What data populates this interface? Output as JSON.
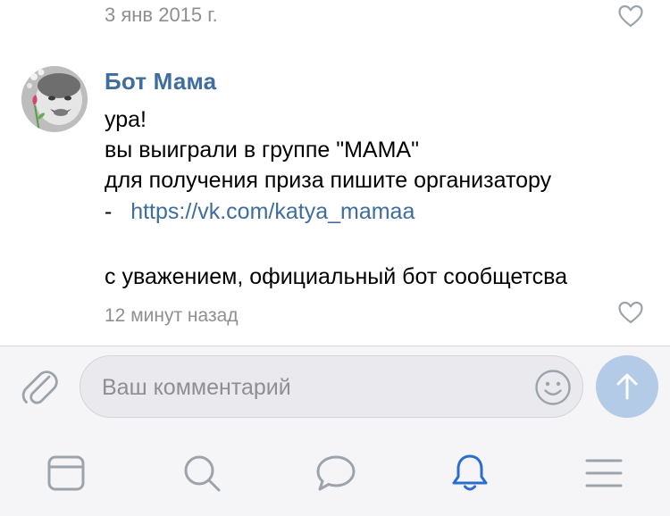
{
  "previous_comment": {
    "date": "3 янв 2015 г.",
    "like_icon": "heart-outline-icon"
  },
  "comment": {
    "author": "Бот Мама",
    "lines": [
      "ура!",
      "вы выиграли в группе \"МАМА\"",
      "для получения приза пишите организатору",
      "- "
    ],
    "link": "https://vk.com/katya_mamaa",
    "signature": "с уважением, официальный бот сообщетсва",
    "time": "12 минут назад",
    "like_icon": "heart-outline-icon"
  },
  "composer": {
    "placeholder": "Ваш комментарий",
    "value": "",
    "attach_icon": "paperclip-icon",
    "emoji_icon": "smiley-icon",
    "send_icon": "arrow-up-icon"
  },
  "tabbar": {
    "tabs": [
      {
        "icon": "news-icon",
        "active": false
      },
      {
        "icon": "search-icon",
        "active": false
      },
      {
        "icon": "messages-icon",
        "active": false
      },
      {
        "icon": "bell-icon",
        "active": true
      },
      {
        "icon": "menu-icon",
        "active": false
      }
    ]
  },
  "colors": {
    "accent": "#3f6d9e",
    "active_tab": "#2a6dd1",
    "inactive_icon": "#9da3ab",
    "meta_text": "#8e8e93",
    "send_button": "#b3cbe7"
  }
}
